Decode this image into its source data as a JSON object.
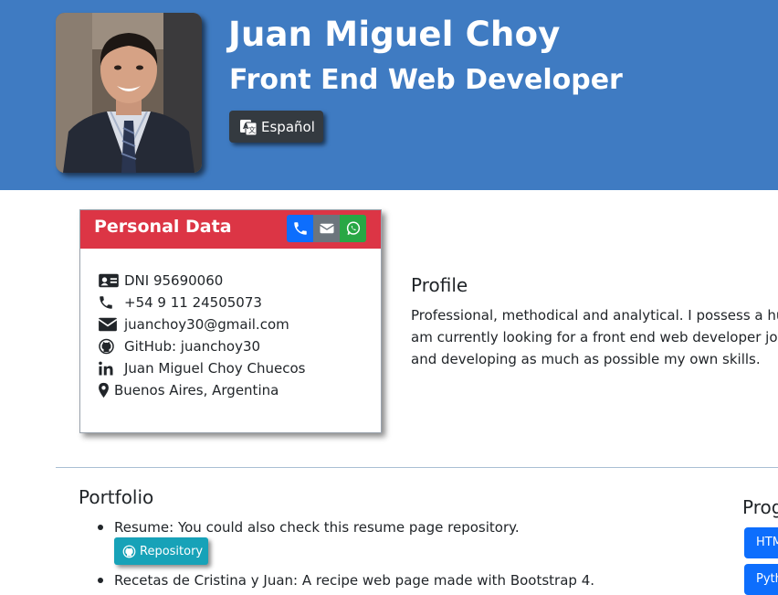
{
  "header": {
    "name": "Juan Miguel Choy",
    "role": "Front End Web Developer",
    "language_button": "Español",
    "background_color": "#3f7bc2"
  },
  "personal_card": {
    "title": "Personal Data",
    "header_color": "#dc3545",
    "contact_buttons": [
      {
        "icon": "phone-icon",
        "color": "#0d6efd"
      },
      {
        "icon": "envelope-icon",
        "color": "#6c757d"
      },
      {
        "icon": "whatsapp-icon",
        "color": "#28a745"
      }
    ],
    "items": [
      {
        "icon": "id-card-icon",
        "text": "DNI 95690060"
      },
      {
        "icon": "phone-icon",
        "text": "+54 9 11 24505073"
      },
      {
        "icon": "envelope-icon",
        "text": "juanchoy30@gmail.com"
      },
      {
        "icon": "github-icon",
        "text": "GitHub: juanchoy30"
      },
      {
        "icon": "linkedin-icon",
        "text": "Juan Miguel Choy Chuecos"
      },
      {
        "icon": "map-marker-icon",
        "text": "Buenos Aires, Argentina"
      }
    ]
  },
  "profile": {
    "title": "Profile",
    "lines": [
      "Professional, methodical and analytical. I possess a huge i",
      "am currently looking for a front end web developer job. I",
      "and developing as much as possible my own skills."
    ]
  },
  "portfolio": {
    "title": "Portfolio",
    "items": [
      {
        "text": "Resume: You could also check this resume page repository.",
        "button": "Repository"
      },
      {
        "text": "Recetas de Cristina y Juan: A recipe web page made with Bootstrap 4."
      }
    ],
    "button_color": "#17a2b8"
  },
  "programming": {
    "title": "Prog",
    "buttons": [
      "HTM",
      "Pyth"
    ],
    "button_color": "#0d6efd"
  }
}
